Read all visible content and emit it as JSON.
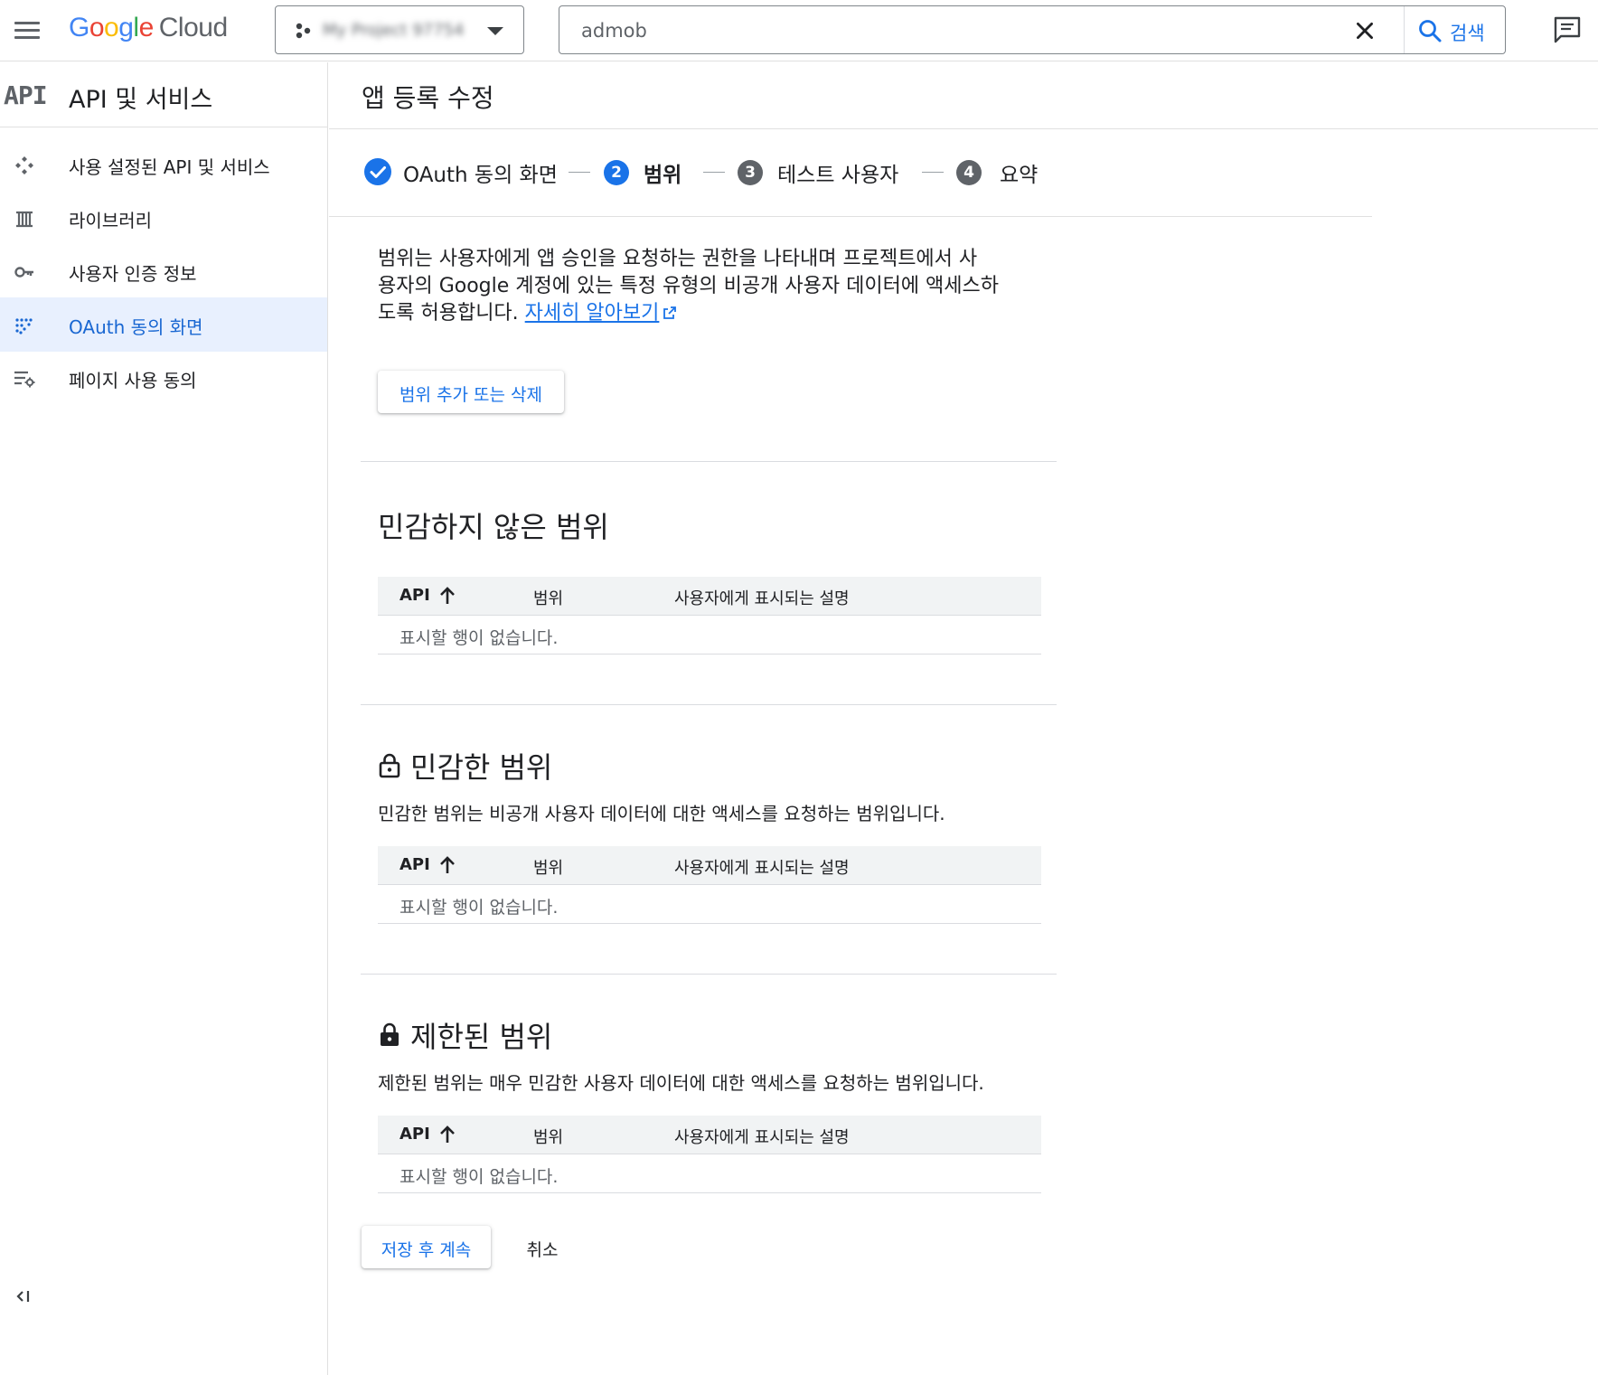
{
  "topbar": {
    "logo": {
      "g1": "G",
      "o1": "o",
      "o2": "o",
      "g2": "g",
      "l": "l",
      "e": "e",
      "cloud": "Cloud"
    },
    "project_name": "My Project 97754",
    "search_value": "admob",
    "search_button": "검색"
  },
  "nav": {
    "logo": "API",
    "title": "API 및 서비스",
    "items": [
      {
        "label": "사용 설정된 API 및 서비스",
        "icon": "enabled-apis-icon"
      },
      {
        "label": "라이브러리",
        "icon": "library-icon"
      },
      {
        "label": "사용자 인증 정보",
        "icon": "key-icon"
      },
      {
        "label": "OAuth 동의 화면",
        "icon": "oauth-consent-icon",
        "active": true
      },
      {
        "label": "페이지 사용 동의",
        "icon": "page-consent-icon"
      }
    ]
  },
  "page": {
    "title": "앱 등록 수정",
    "steps": [
      {
        "num": "",
        "label": "OAuth 동의 화면",
        "state": "done"
      },
      {
        "num": "2",
        "label": "범위",
        "state": "current"
      },
      {
        "num": "3",
        "label": "테스트 사용자",
        "state": "todo"
      },
      {
        "num": "4",
        "label": "요약",
        "state": "todo"
      }
    ],
    "intro": {
      "line1": "범위는 사용자에게 앱 승인을 요청하는 권한을 나타내며 프로젝트에서 사",
      "line2": "용자의 Google 계정에 있는 특정 유형의 비공개 사용자 데이터에 액세스하",
      "line3": "도록 허용합니다. ",
      "link": "자세히 알아보기"
    },
    "add_button": "범위 추가 또는 삭제",
    "table_headers": {
      "api": "API",
      "scope": "범위",
      "desc": "사용자에게 표시되는 설명"
    },
    "empty_text": "표시할 행이 없습니다.",
    "sections": {
      "non_sensitive": {
        "title": "민감하지 않은 범위"
      },
      "sensitive": {
        "title": "민감한 범위",
        "desc": "민감한 범위는 비공개 사용자 데이터에 대한 액세스를 요청하는 범위입니다."
      },
      "restricted": {
        "title": "제한된 범위",
        "desc": "제한된 범위는 매우 민감한 사용자 데이터에 대한 액세스를 요청하는 범위입니다."
      }
    },
    "save_button": "저장 후 계속",
    "cancel_button": "취소"
  },
  "colors": {
    "accent": "#1a73e8",
    "active_bg": "#e8f0fe",
    "text": "#202124",
    "muted": "#5f6368"
  }
}
